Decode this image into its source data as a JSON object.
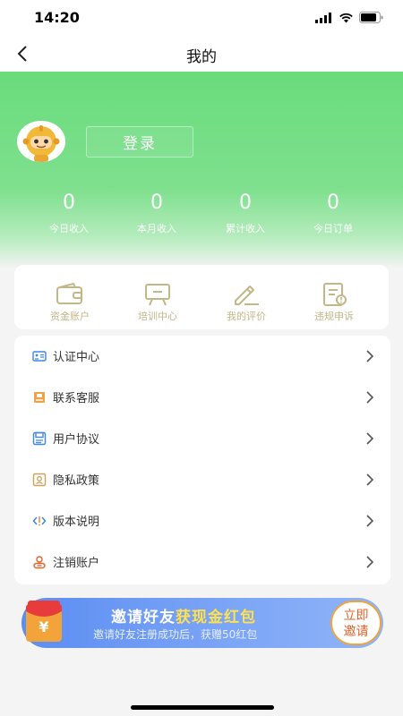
{
  "status_bar": {
    "time": "14:20"
  },
  "nav": {
    "title": "我的"
  },
  "profile": {
    "login_label": "登录"
  },
  "stats": [
    {
      "value": "0",
      "label": "今日收入"
    },
    {
      "value": "0",
      "label": "本月收入"
    },
    {
      "value": "0",
      "label": "累计收入"
    },
    {
      "value": "0",
      "label": "今日订单"
    }
  ],
  "quick_actions": [
    {
      "label": "资金账户",
      "icon": "wallet-icon"
    },
    {
      "label": "培训中心",
      "icon": "training-board-icon"
    },
    {
      "label": "我的评价",
      "icon": "edit-pen-icon"
    },
    {
      "label": "违规申诉",
      "icon": "appeal-document-icon"
    }
  ],
  "menu": [
    {
      "label": "认证中心",
      "icon": "id-card-icon"
    },
    {
      "label": "联系客服",
      "icon": "customer-service-icon"
    },
    {
      "label": "用户协议",
      "icon": "agreement-icon"
    },
    {
      "label": "隐私政策",
      "icon": "privacy-icon"
    },
    {
      "label": "版本说明",
      "icon": "version-code-icon"
    },
    {
      "label": "注销账户",
      "icon": "logout-user-icon"
    }
  ],
  "banner": {
    "title_prefix": "邀请好友",
    "title_highlight": "获现金红包",
    "subtitle": "邀请好友注册成功后，获赠50红包",
    "button_line1": "立即",
    "button_line2": "邀请",
    "gift_symbol": "¥"
  },
  "colors": {
    "accent_green": "#69dc7c",
    "quick_label": "#c3b687",
    "banner_blue": "#5b8df2",
    "highlight_yellow": "#ffe14f"
  }
}
